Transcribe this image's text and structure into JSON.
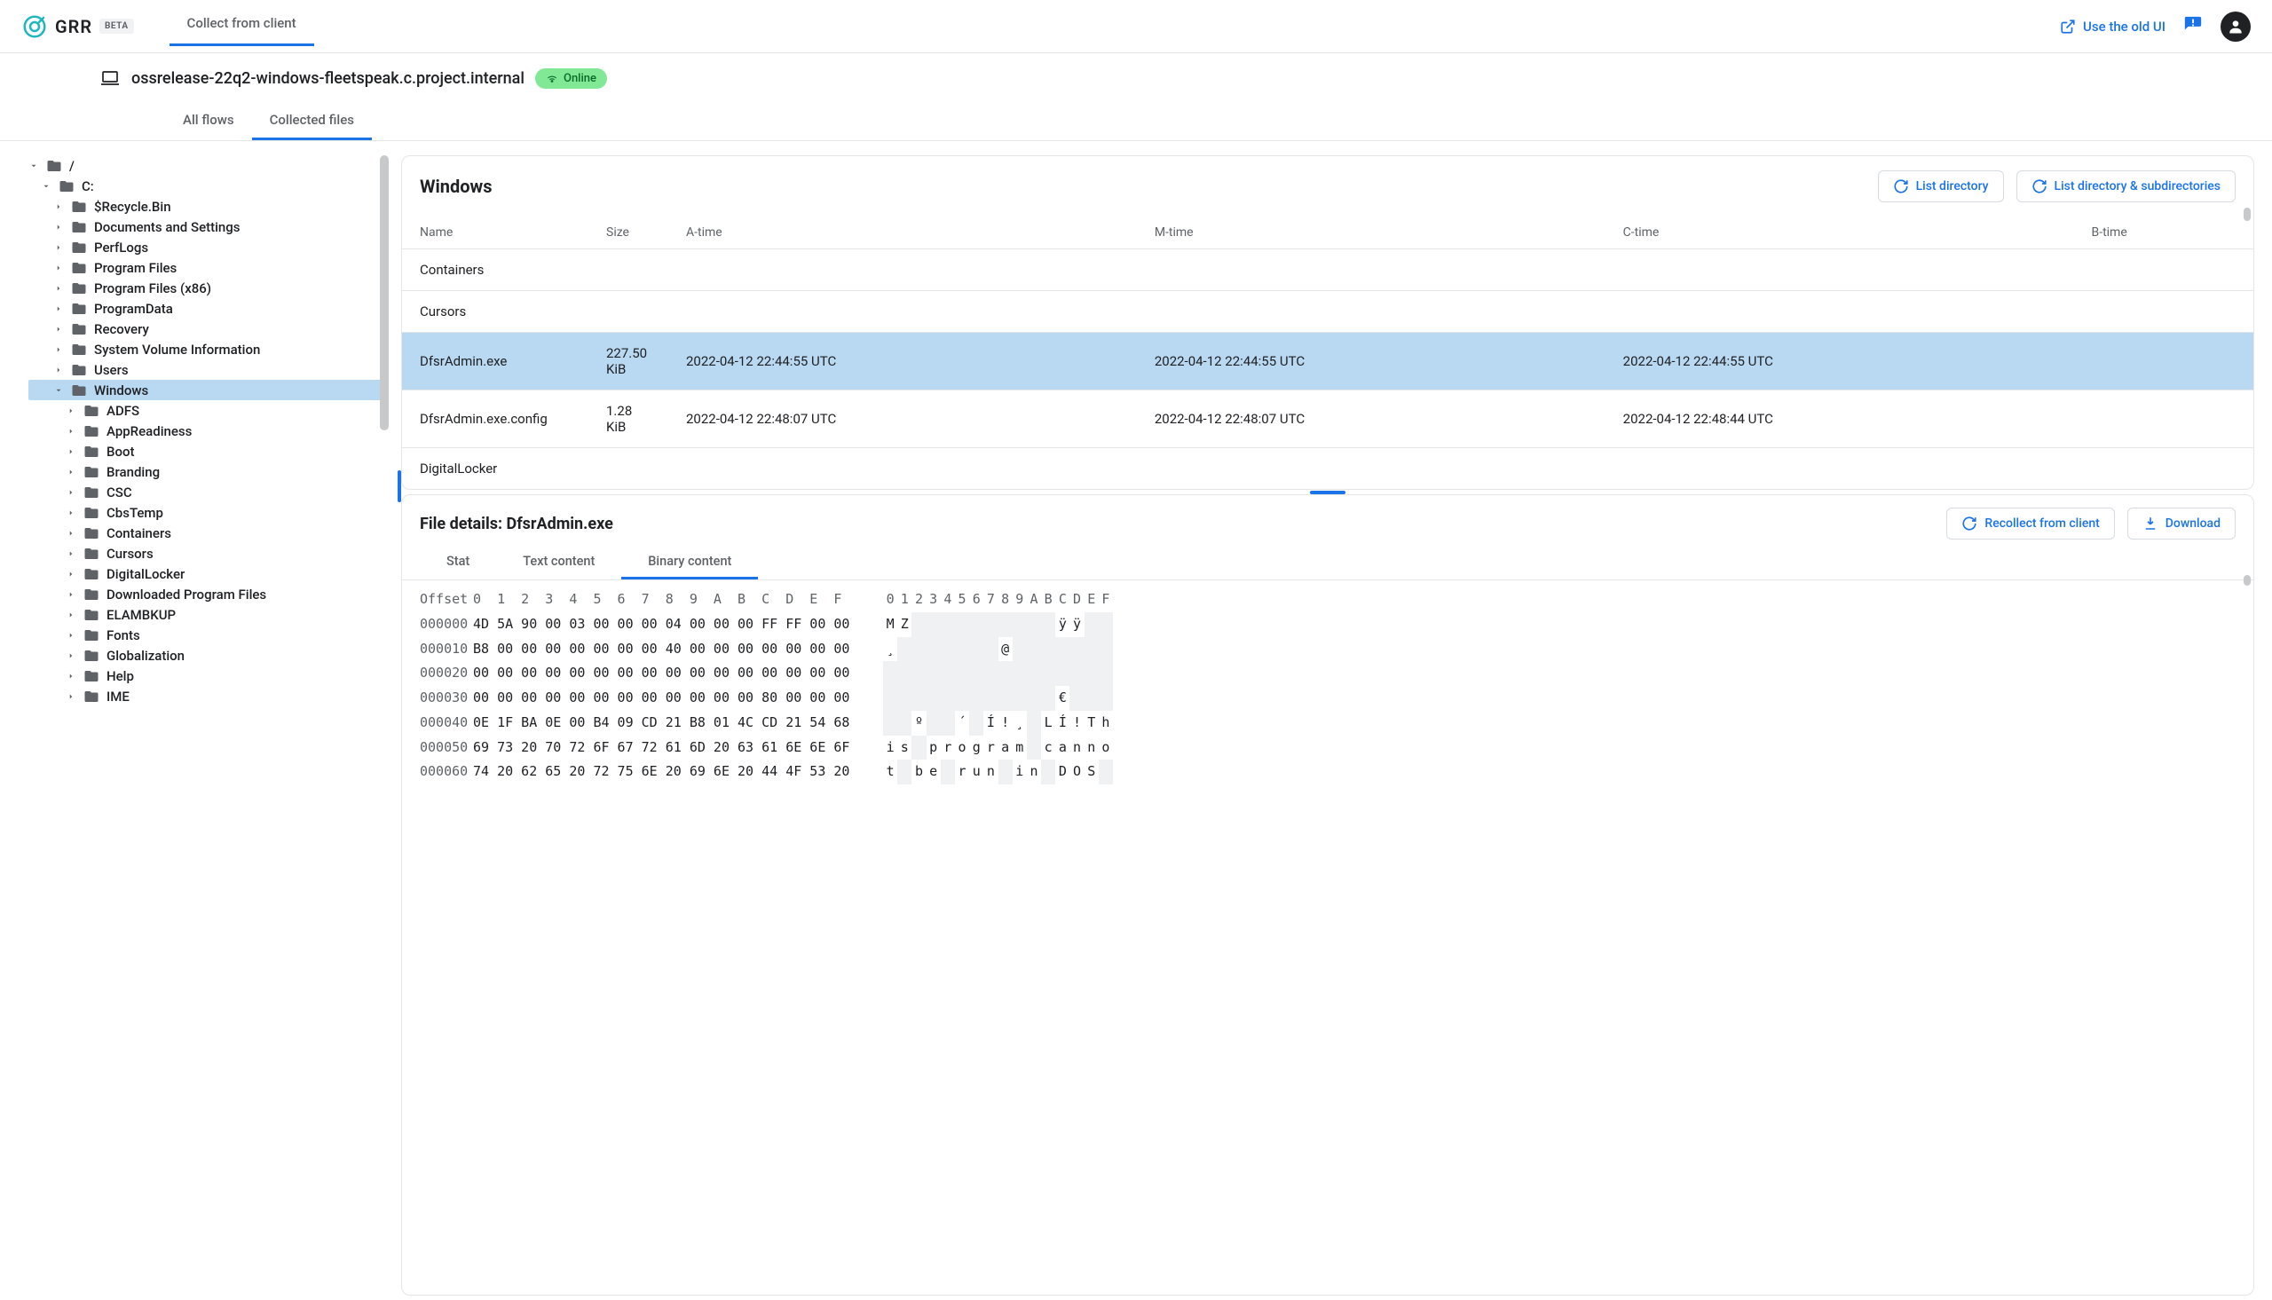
{
  "header": {
    "app_name": "GRR",
    "beta_label": "BETA",
    "search_placeholder": "Collect from client",
    "old_ui_label": "Use the old UI"
  },
  "client": {
    "hostname": "ossrelease-22q2-windows-fleetspeak.c.project.internal",
    "online_label": "Online"
  },
  "tabs": {
    "all_flows": "All flows",
    "collected_files": "Collected files"
  },
  "tree": {
    "root": "/",
    "drive": "C:",
    "top_level": [
      "$Recycle.Bin",
      "Documents and Settings",
      "PerfLogs",
      "Program Files",
      "Program Files (x86)",
      "ProgramData",
      "Recovery",
      "System Volume Information",
      "Users"
    ],
    "selected": "Windows",
    "windows_children": [
      "ADFS",
      "AppReadiness",
      "Boot",
      "Branding",
      "CSC",
      "CbsTemp",
      "Containers",
      "Cursors",
      "DigitalLocker",
      "Downloaded Program Files",
      "ELAMBKUP",
      "Fonts",
      "Globalization",
      "Help",
      "IME"
    ]
  },
  "listing": {
    "title": "Windows",
    "list_dir_label": "List directory",
    "list_subdir_label": "List directory & subdirectories",
    "columns": {
      "name": "Name",
      "size": "Size",
      "atime": "A-time",
      "mtime": "M-time",
      "ctime": "C-time",
      "btime": "B-time"
    },
    "rows": [
      {
        "name": "Containers",
        "size": "",
        "atime": "",
        "mtime": "",
        "ctime": "",
        "btime": ""
      },
      {
        "name": "Cursors",
        "size": "",
        "atime": "",
        "mtime": "",
        "ctime": "",
        "btime": ""
      },
      {
        "name": "DfsrAdmin.exe",
        "size": "227.50 KiB",
        "atime": "2022-04-12 22:44:55 UTC",
        "mtime": "2022-04-12 22:44:55 UTC",
        "ctime": "2022-04-12 22:44:55 UTC",
        "btime": "",
        "selected": true
      },
      {
        "name": "DfsrAdmin.exe.config",
        "size": "1.28 KiB",
        "atime": "2022-04-12 22:48:07 UTC",
        "mtime": "2022-04-12 22:48:07 UTC",
        "ctime": "2022-04-12 22:48:44 UTC",
        "btime": ""
      },
      {
        "name": "DigitalLocker",
        "size": "",
        "atime": "",
        "mtime": "",
        "ctime": "",
        "btime": ""
      }
    ]
  },
  "details": {
    "title_prefix": "File details: ",
    "title_file": "DfsrAdmin.exe",
    "recollect_label": "Recollect from client",
    "download_label": "Download",
    "tabs": {
      "stat": "Stat",
      "text": "Text content",
      "binary": "Binary content"
    },
    "hex_header_hex": "Offset  0  1  2  3  4  5  6  7  8  9  A  B  C  D  E  F",
    "hex_header_ascii": "0 1 2 3 4 5 6 7 8 9 A B C D E F",
    "hex_rows": [
      {
        "off": "000000",
        "hex": "4D 5A 90 00 03 00 00 00 04 00 00 00 FF FF 00 00",
        "ascii": "M Z                     ÿ ÿ    "
      },
      {
        "off": "000010",
        "hex": "B8 00 00 00 00 00 00 00 40 00 00 00 00 00 00 00",
        "ascii": "¸               @              "
      },
      {
        "off": "000020",
        "hex": "00 00 00 00 00 00 00 00 00 00 00 00 00 00 00 00",
        "ascii": "                               "
      },
      {
        "off": "000030",
        "hex": "00 00 00 00 00 00 00 00 00 00 00 00 80 00 00 00",
        "ascii": "                        €      "
      },
      {
        "off": "000040",
        "hex": "0E 1F BA 0E 00 B4 09 CD 21 B8 01 4C CD 21 54 68",
        "ascii": "    º     ´   Í ! ¸   L Í ! T h"
      },
      {
        "off": "000050",
        "hex": "69 73 20 70 72 6F 67 72 61 6D 20 63 61 6E 6E 6F",
        "ascii": "i s   p r o g r a m   c a n n o"
      },
      {
        "off": "000060",
        "hex": "74 20 62 65 20 72 75 6E 20 69 6E 20 44 4F 53 20",
        "ascii": "t   b e   r u n   i n   D O S  "
      }
    ]
  }
}
